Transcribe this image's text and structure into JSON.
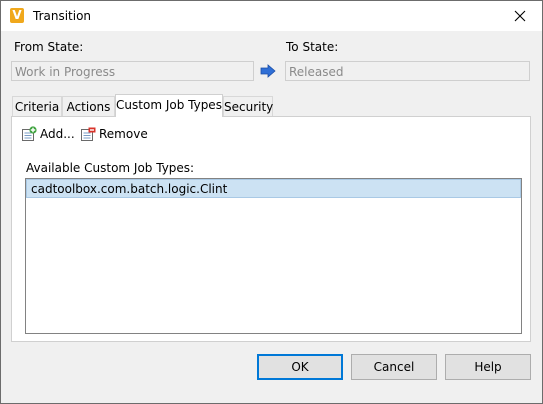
{
  "window": {
    "title": "Transition",
    "app_icon_letter": "V"
  },
  "from_state": {
    "label": "From State:",
    "value": "Work in Progress"
  },
  "to_state": {
    "label": "To State:",
    "value": "Released"
  },
  "tabs": [
    {
      "label": "Criteria",
      "active": false
    },
    {
      "label": "Actions",
      "active": false
    },
    {
      "label": "Custom Job Types",
      "active": true
    },
    {
      "label": "Security",
      "active": false
    }
  ],
  "toolbar": {
    "add_label": "Add...",
    "remove_label": "Remove"
  },
  "job_types": {
    "label": "Available Custom Job Types:",
    "items": [
      {
        "text": "cadtoolbox.com.batch.logic.Clint",
        "selected": true
      }
    ]
  },
  "buttons": {
    "ok": "OK",
    "cancel": "Cancel",
    "help": "Help"
  },
  "colors": {
    "selection": "#cce2f3",
    "default_button_border": "#0078d7",
    "arrow": "#2f6fd6",
    "app_icon": "#f0a81c"
  }
}
